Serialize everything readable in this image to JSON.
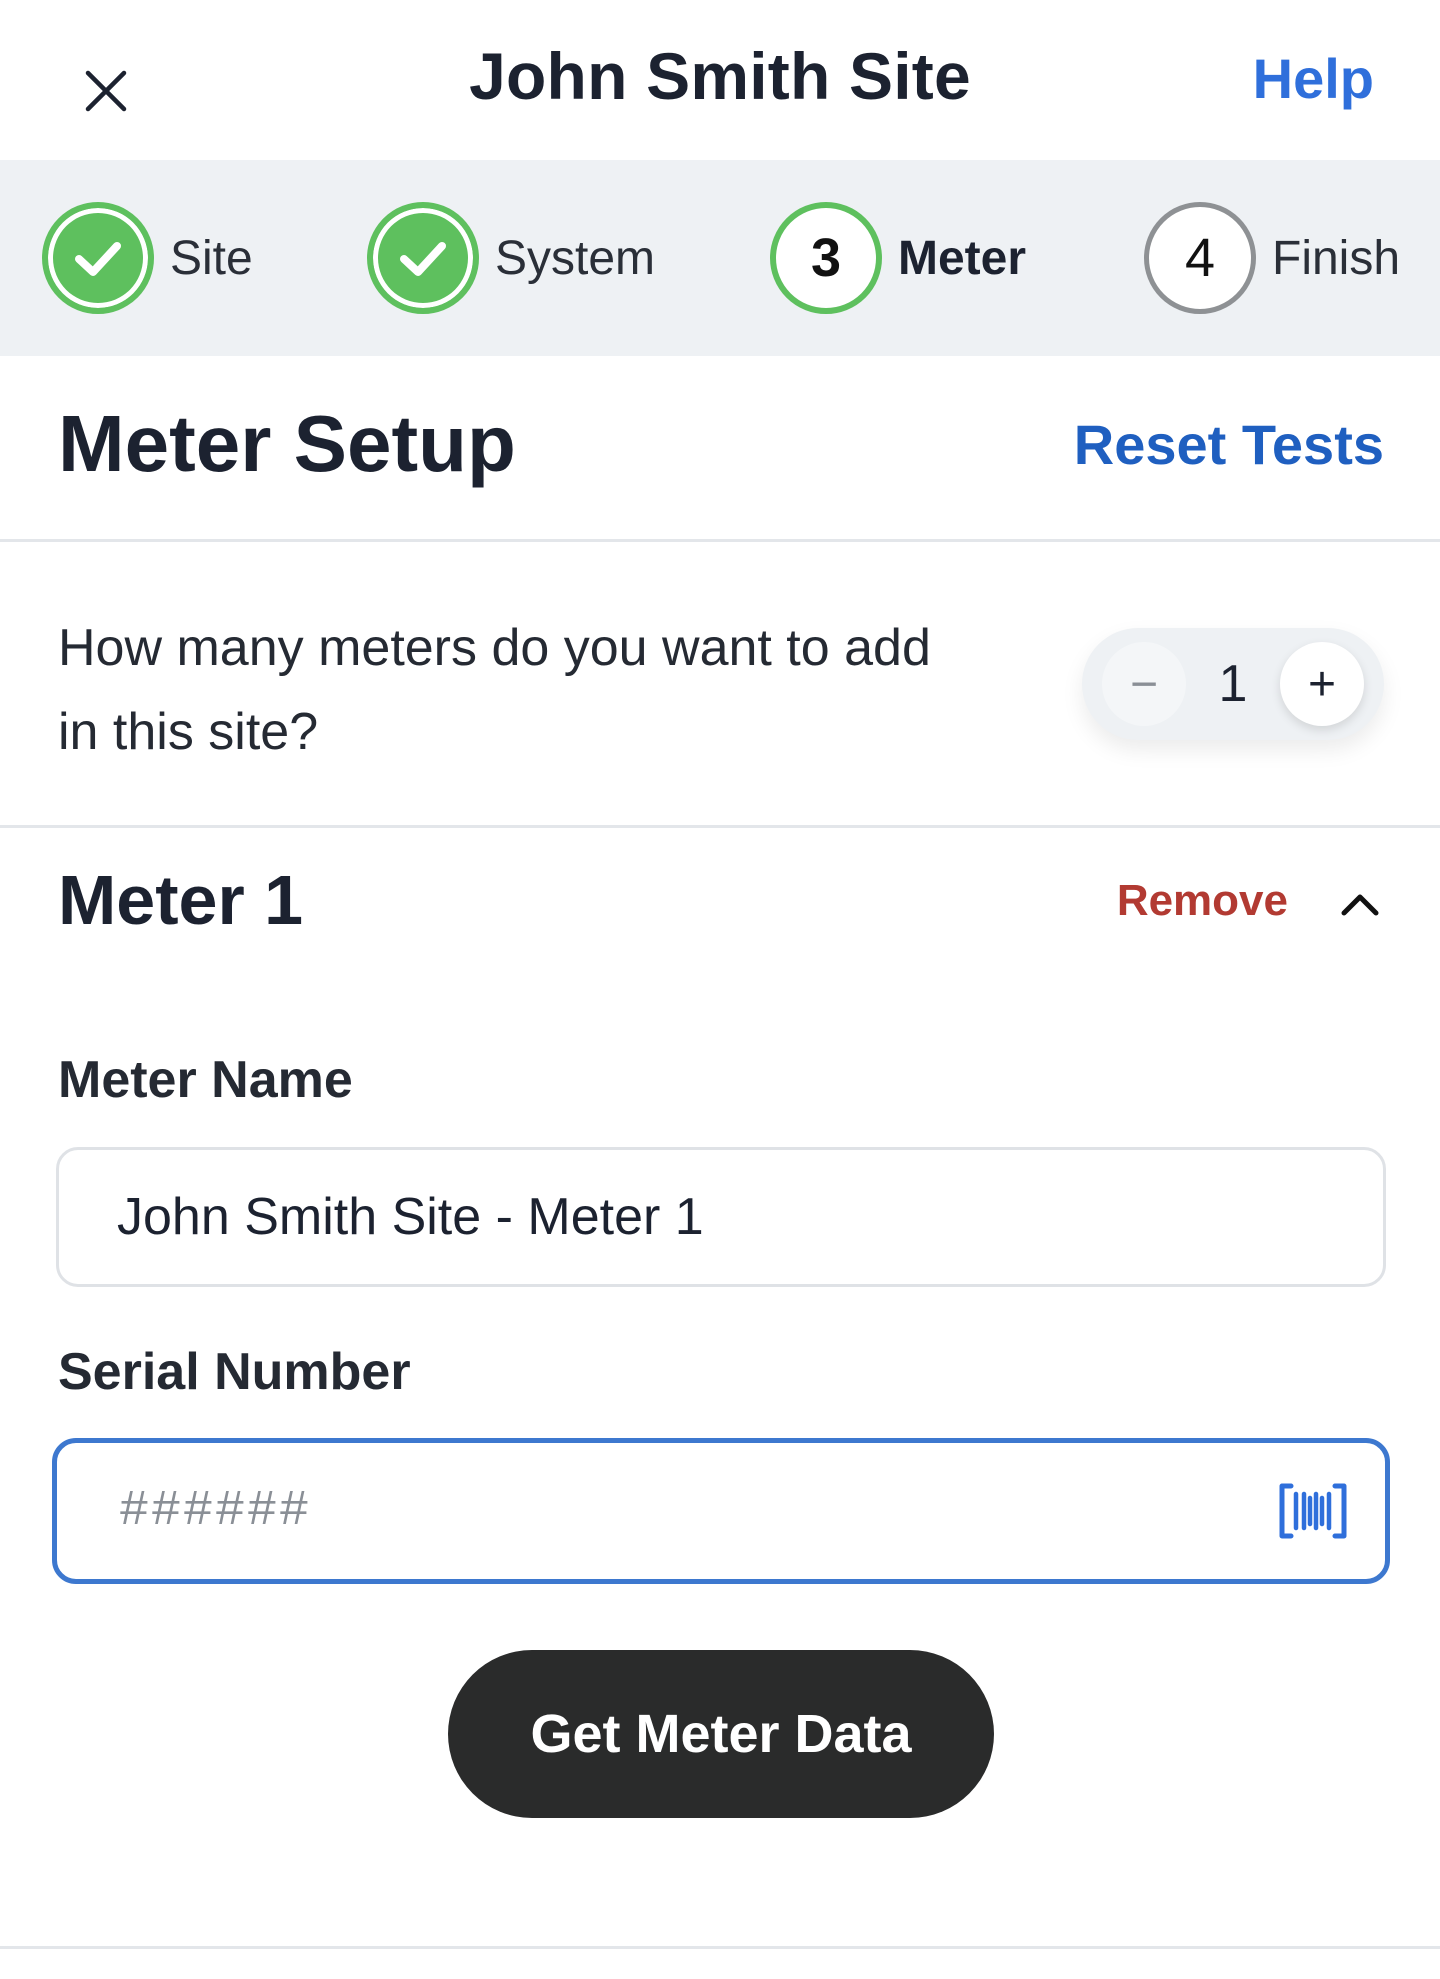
{
  "header": {
    "title": "John Smith Site",
    "help_label": "Help",
    "close_icon": "close-icon"
  },
  "steps": [
    {
      "label": "Site",
      "number": "1",
      "status": "complete"
    },
    {
      "label": "System",
      "number": "2",
      "status": "complete"
    },
    {
      "label": "Meter",
      "number": "3",
      "status": "current"
    },
    {
      "label": "Finish",
      "number": "4",
      "status": "upcoming"
    }
  ],
  "section": {
    "title": "Meter Setup",
    "reset_label": "Reset Tests"
  },
  "meter_count": {
    "question": "How many meters do you want to add in this site?",
    "value": "1",
    "decrement_symbol": "−",
    "increment_symbol": "+"
  },
  "meter": {
    "title": "Meter 1",
    "remove_label": "Remove",
    "collapse_icon": "chevron-up-icon",
    "name_label": "Meter Name",
    "name_value": "John Smith Site - Meter 1",
    "serial_label": "Serial Number",
    "serial_value": "",
    "serial_placeholder": "######",
    "scan_icon": "barcode-scan-icon"
  },
  "actions": {
    "get_data_label": "Get Meter Data"
  },
  "colors": {
    "accent_blue": "#2f6fdb",
    "success_green": "#5ec05e",
    "danger_red": "#b23a32",
    "primary_button": "#2a2b2b",
    "stepper_bg": "#eef1f4"
  }
}
